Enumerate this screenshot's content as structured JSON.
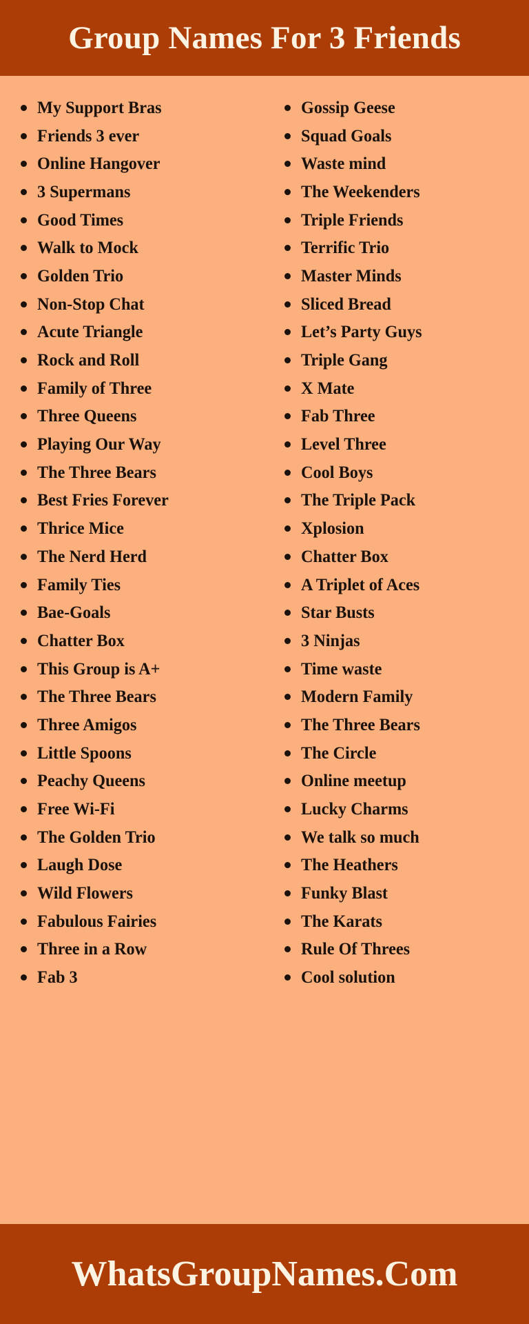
{
  "header": {
    "title": "Group Names For 3 Friends",
    "background_color": "#AC3D06",
    "text_color": "#FDF3E3"
  },
  "body": {
    "background_color": "#FCB07E",
    "text_color": "#1C120C",
    "bullet_glyph": "•"
  },
  "footer": {
    "title": "WhatsGroupNames.Com",
    "background_color": "#AC3D06",
    "text_color": "#FDF3E3"
  },
  "columns": [
    {
      "id": "left",
      "items": [
        "My Support Bras",
        "Friends 3 ever",
        "Online Hangover",
        "3 Supermans",
        "Good Times",
        "Walk to Mock",
        "Golden Trio",
        "Non-Stop Chat",
        "Acute Triangle",
        "Rock and Roll",
        "Family of Three",
        "Three Queens",
        "Playing Our Way",
        "The Three Bears",
        "Best Fries Forever",
        "Thrice Mice",
        "The Nerd Herd",
        "Family Ties",
        "Bae-Goals",
        "Chatter Box",
        "This Group is A+",
        "The Three Bears",
        "Three Amigos",
        "Little Spoons",
        "Peachy Queens",
        "Free Wi-Fi",
        "The Golden Trio",
        "Laugh Dose",
        "Wild Flowers",
        "Fabulous Fairies",
        "Three in a Row",
        "Fab 3"
      ]
    },
    {
      "id": "right",
      "items": [
        "Gossip Geese",
        "Squad Goals",
        "Waste mind",
        "The Weekenders",
        "Triple Friends",
        "Terrific Trio",
        "Master Minds",
        "Sliced Bread",
        "Let’s Party Guys",
        "Triple Gang",
        "X Mate",
        "Fab Three",
        "Level Three",
        "Cool Boys",
        "The Triple Pack",
        "Xplosion",
        "Chatter Box",
        "A Triplet of Aces",
        "Star Busts",
        "3 Ninjas",
        "Time waste",
        "Modern Family",
        "The Three Bears",
        "The Circle",
        "Online meetup",
        "Lucky Charms",
        "We talk so much",
        "The Heathers",
        "Funky Blast",
        "The Karats",
        "Rule Of Threes",
        "Cool solution"
      ]
    }
  ]
}
